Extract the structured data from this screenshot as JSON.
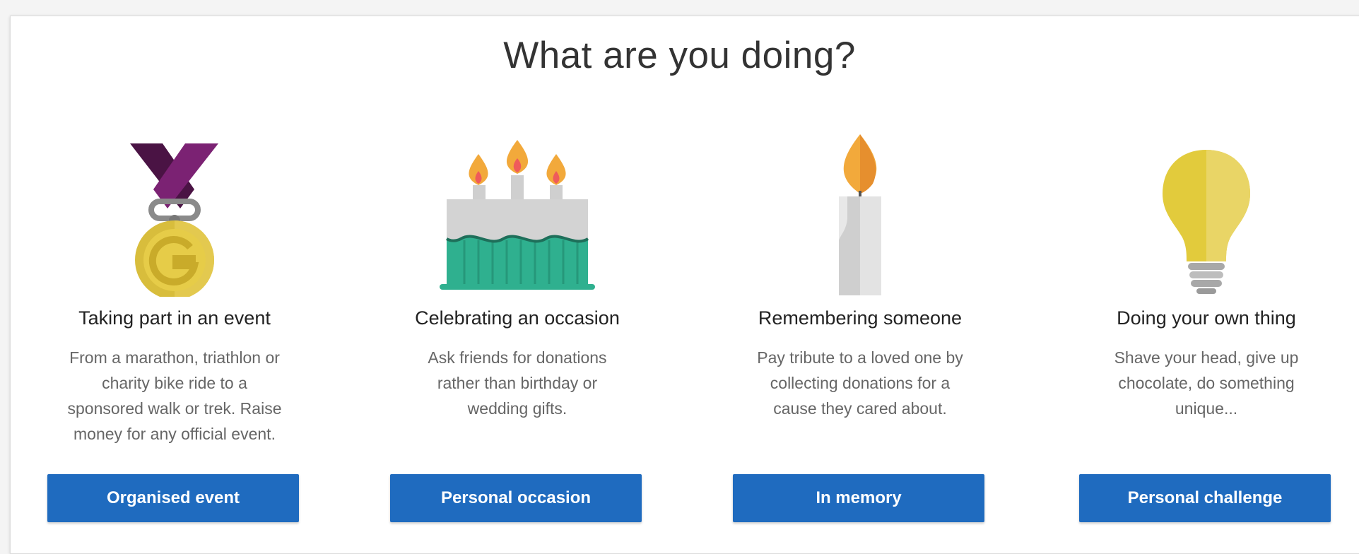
{
  "heading": "What are you doing?",
  "colors": {
    "button_bg": "#1f6bbf",
    "button_text": "#ffffff",
    "heading_text": "#333333",
    "desc_text": "#666666"
  },
  "cards": [
    {
      "icon": "medal-icon",
      "title": "Taking part in an event",
      "description": "From a marathon, triathlon or charity bike ride to a sponsored walk or trek. Raise money for any official event.",
      "button": "Organised event"
    },
    {
      "icon": "birthday-cake-icon",
      "title": "Celebrating an occasion",
      "description": "Ask friends for donations rather than birthday or wedding gifts.",
      "button": "Personal occasion"
    },
    {
      "icon": "candle-icon",
      "title": "Remembering someone",
      "description": "Pay tribute to a loved one by collecting donations for a cause they cared about.",
      "button": "In memory"
    },
    {
      "icon": "light-bulb-icon",
      "title": "Doing your own thing",
      "description": "Shave your head, give up chocolate, do something unique...",
      "button": "Personal challenge"
    }
  ]
}
